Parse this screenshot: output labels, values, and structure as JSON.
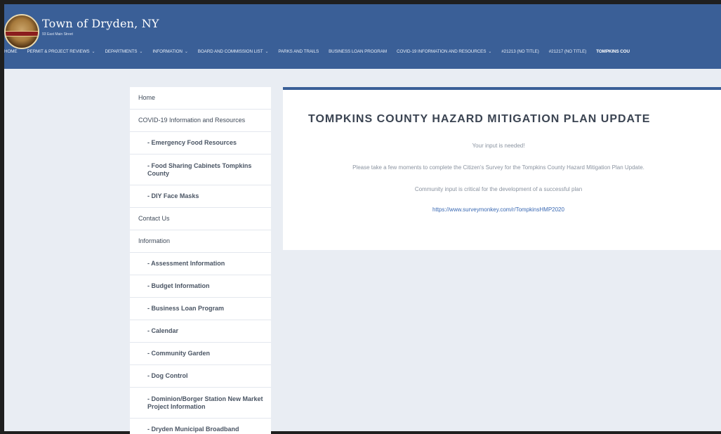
{
  "header": {
    "title": "Town of Dryden, NY",
    "subtitle": "93 East Main Street",
    "logo_icon": "town-seal-icon",
    "colors": {
      "header_bg": "#3a5f97",
      "page_bg": "#e9edf3",
      "link": "#3a69b3"
    }
  },
  "nav": [
    {
      "label": "HOME",
      "dropdown": false
    },
    {
      "label": "PERMIT & PROJECT REVIEWS",
      "dropdown": true
    },
    {
      "label": "DEPARTMENTS",
      "dropdown": true
    },
    {
      "label": "INFORMATION",
      "dropdown": true
    },
    {
      "label": "BOARD AND COMMISSION LIST",
      "dropdown": true
    },
    {
      "label": "PARKS AND TRAILS",
      "dropdown": false
    },
    {
      "label": "BUSINESS LOAN PROGRAM",
      "dropdown": false
    },
    {
      "label": "COVID-19 INFORMATION AND RESOURCES",
      "dropdown": true
    },
    {
      "label": "#21213 (NO TITLE)",
      "dropdown": false
    },
    {
      "label": "#21217 (NO TITLE)",
      "dropdown": false
    },
    {
      "label": "TOMPKINS COU",
      "dropdown": false,
      "active": true
    }
  ],
  "sidebar": {
    "items": [
      {
        "label": "Home",
        "sub": false
      },
      {
        "label": "COVID-19 Information and Resources",
        "sub": false
      },
      {
        "label": "- Emergency Food Resources",
        "sub": true
      },
      {
        "label": "- Food Sharing Cabinets Tompkins County",
        "sub": true
      },
      {
        "label": "- DIY Face Masks",
        "sub": true
      },
      {
        "label": "Contact Us",
        "sub": false
      },
      {
        "label": "Information",
        "sub": false
      },
      {
        "label": "- Assessment Information",
        "sub": true
      },
      {
        "label": "- Budget Information",
        "sub": true
      },
      {
        "label": "- Business Loan Program",
        "sub": true
      },
      {
        "label": "- Calendar",
        "sub": true
      },
      {
        "label": "- Community Garden",
        "sub": true
      },
      {
        "label": "- Dog Control",
        "sub": true
      },
      {
        "label": "- Dominion/Borger Station New Market Project Information",
        "sub": true
      },
      {
        "label": "- Dryden Municipal Broadband",
        "sub": true
      }
    ]
  },
  "main": {
    "title": "TOMPKINS COUNTY HAZARD MITIGATION PLAN UPDATE",
    "line1": "Your input is needed!",
    "line2": "Please take a few moments to complete the Citizen's Survey for the Tompkins County Hazard Mitigation Plan Update.",
    "line3": "Community input is critical for the development of a successful plan",
    "link": "https://www.surveymonkey.com/r/TompkinsHMP2020"
  }
}
